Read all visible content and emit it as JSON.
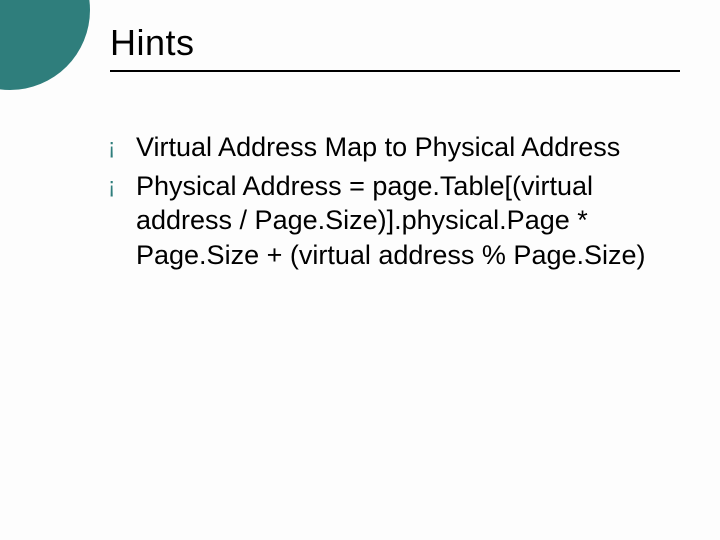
{
  "slide": {
    "title": "Hints",
    "bullets": [
      {
        "text": "Virtual Address Map to Physical Address"
      },
      {
        "text": "Physical Address = page.Table[(virtual address / Page.Size)].physical.Page * Page.Size + (virtual address % Page.Size)"
      }
    ]
  },
  "style": {
    "accent_color": "#2f7e7c",
    "bullet_glyph": "¡"
  }
}
